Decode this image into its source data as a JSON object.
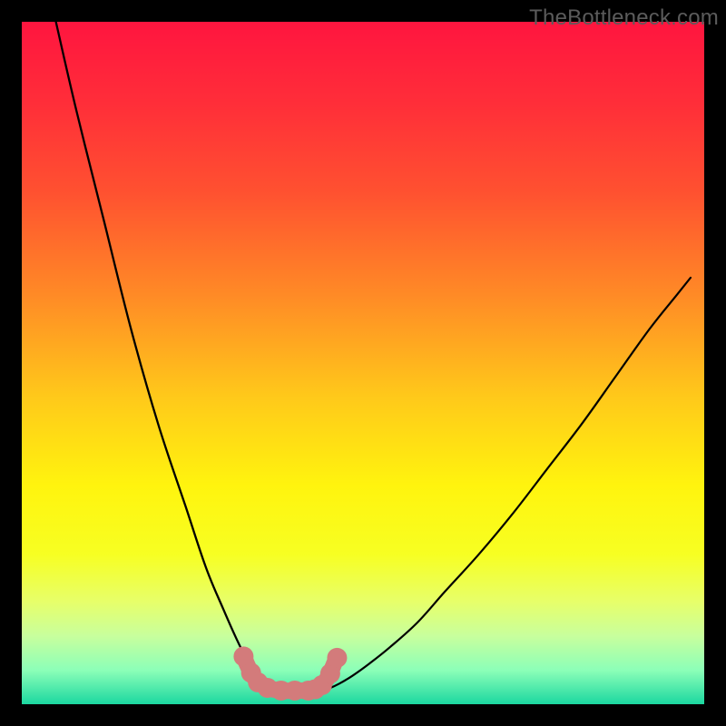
{
  "watermark": "TheBottleneck.com",
  "chart_data": {
    "type": "line",
    "title": "",
    "xlabel": "",
    "ylabel": "",
    "xlim": [
      0,
      100
    ],
    "ylim": [
      0,
      100
    ],
    "grid": false,
    "legend": null,
    "background": {
      "gradient_stops": [
        {
          "pos": 0.0,
          "color": "#ff153f"
        },
        {
          "pos": 0.12,
          "color": "#ff2e39"
        },
        {
          "pos": 0.25,
          "color": "#ff5130"
        },
        {
          "pos": 0.4,
          "color": "#ff8a26"
        },
        {
          "pos": 0.55,
          "color": "#ffc91a"
        },
        {
          "pos": 0.68,
          "color": "#fff40e"
        },
        {
          "pos": 0.78,
          "color": "#f7ff22"
        },
        {
          "pos": 0.85,
          "color": "#e7ff6a"
        },
        {
          "pos": 0.9,
          "color": "#c8ff9d"
        },
        {
          "pos": 0.95,
          "color": "#8cffb8"
        },
        {
          "pos": 1.0,
          "color": "#1bd7a0"
        }
      ]
    },
    "curve_left": {
      "name": "left-falling-curve",
      "color": "#000000",
      "x": [
        5,
        8,
        12,
        16,
        20,
        24,
        27,
        29.5,
        31.5,
        33,
        34.2,
        35,
        35.8,
        36.5,
        37.2,
        38
      ],
      "y": [
        100,
        87,
        71,
        55,
        41,
        29,
        20,
        14,
        9.5,
        6.5,
        4.5,
        3.5,
        2.8,
        2.4,
        2.1,
        2.0
      ]
    },
    "curve_right": {
      "name": "right-rising-curve",
      "color": "#000000",
      "x": [
        44,
        45,
        46.5,
        48.5,
        51,
        54,
        58,
        62,
        67,
        72,
        77,
        82,
        87,
        92,
        96,
        98
      ],
      "y": [
        2.0,
        2.3,
        3.0,
        4.2,
        6.0,
        8.4,
        12,
        16.5,
        22,
        28,
        34.5,
        41,
        48,
        55,
        60,
        62.5
      ]
    },
    "valley_bed": {
      "name": "valley-floor",
      "color": "#d37b7b",
      "x": [
        32.5,
        34,
        36,
        38,
        40,
        42,
        43,
        44,
        45,
        46
      ],
      "y": [
        7.0,
        4.0,
        2.5,
        2.0,
        2.0,
        2.0,
        2.2,
        2.8,
        4.2,
        6.5
      ]
    },
    "markers": {
      "name": "valley-dots",
      "color": "#d37b7b",
      "points": [
        {
          "x": 32.5,
          "y": 7.0
        },
        {
          "x": 33.6,
          "y": 4.6
        },
        {
          "x": 34.6,
          "y": 3.2
        },
        {
          "x": 36.0,
          "y": 2.4
        },
        {
          "x": 38.0,
          "y": 2.0
        },
        {
          "x": 40.0,
          "y": 2.0
        },
        {
          "x": 42.0,
          "y": 2.0
        },
        {
          "x": 43.0,
          "y": 2.2
        },
        {
          "x": 44.0,
          "y": 2.8
        },
        {
          "x": 45.2,
          "y": 4.5
        },
        {
          "x": 46.2,
          "y": 6.8
        }
      ]
    },
    "frame": {
      "outer_color": "#000000",
      "inner_margin_pct": 3
    }
  }
}
